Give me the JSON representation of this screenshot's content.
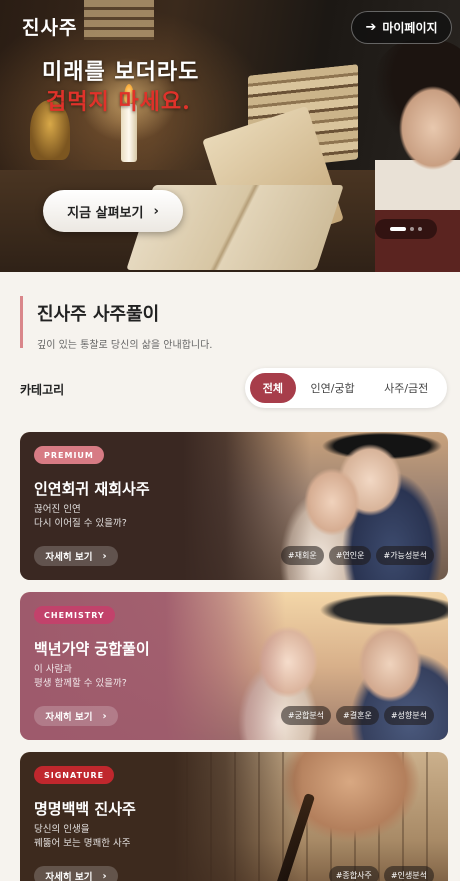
{
  "header": {
    "logo": "진사주",
    "mypage_label": "마이페이지",
    "mypage_icon": "arrow-right-icon"
  },
  "hero": {
    "title_line1": "미래를 보더라도",
    "title_line2": "겁먹지 마세요.",
    "cta_label": "지금 살펴보기",
    "carousel": {
      "total": 3,
      "current": 1
    }
  },
  "section": {
    "title": "진사주 사주풀이",
    "subtitle": "깊이 있는 통찰로 당신의 삶을 안내합니다."
  },
  "category": {
    "label": "카테고리",
    "tabs": [
      {
        "label": "전체",
        "active": true
      },
      {
        "label": "인연/궁합",
        "active": false
      },
      {
        "label": "사주/금전",
        "active": false
      }
    ]
  },
  "cards": [
    {
      "badge": "PREMIUM",
      "title": "인연회귀 재회사주",
      "desc_line1": "끊어진 인연",
      "desc_line2": "다시 이어질 수 있을까?",
      "button": "자세히 보기",
      "tags": [
        "#재회운",
        "#연인운",
        "#가능성분석"
      ]
    },
    {
      "badge": "CHEMISTRY",
      "title": "백년가약 궁합풀이",
      "desc_line1": "이 사람과",
      "desc_line2": "평생 함께할 수 있을까?",
      "button": "자세히 보기",
      "tags": [
        "#궁합분석",
        "#결혼운",
        "#성향분석"
      ]
    },
    {
      "badge": "SIGNATURE",
      "title": "명명백백 진사주",
      "desc_line1": "당신의 인생을",
      "desc_line2": "꿰뚫어 보는 명쾌한 사주",
      "button": "자세히 보기",
      "tags": [
        "#종합사주",
        "#인생분석"
      ]
    }
  ],
  "colors": {
    "accent": "#a73d4a",
    "hero_highlight": "#e0322a",
    "premium_badge": "#d77b84",
    "chemistry_badge": "#c2426b",
    "signature_badge": "#c0272d",
    "background": "#f6f3ee"
  }
}
